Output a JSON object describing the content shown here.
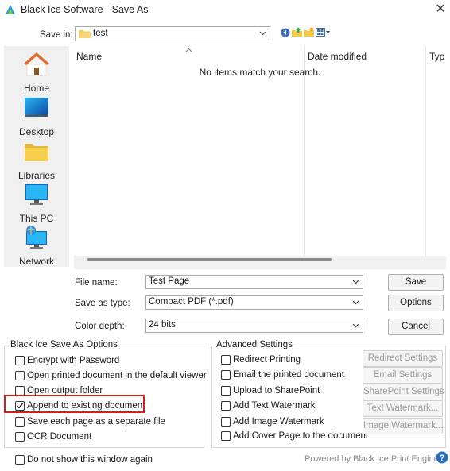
{
  "window": {
    "title": "Black Ice Software - Save As",
    "close_label": "✕"
  },
  "save_in": {
    "label": "Save in:",
    "value": "test"
  },
  "places": [
    {
      "label": "Home"
    },
    {
      "label": "Desktop"
    },
    {
      "label": "Libraries"
    },
    {
      "label": "This PC"
    },
    {
      "label": "Network"
    }
  ],
  "file_list": {
    "columns": [
      "Name",
      "Date modified",
      "Typ"
    ],
    "empty_message": "No items match your search."
  },
  "fields": {
    "file_name_label": "File name:",
    "file_name_value": "Test Page",
    "save_as_type_label": "Save as type:",
    "save_as_type_value": "Compact PDF (*.pdf)",
    "color_depth_label": "Color depth:",
    "color_depth_value": "24 bits"
  },
  "buttons": {
    "save": "Save",
    "options": "Options",
    "cancel": "Cancel"
  },
  "ice_options": {
    "title": "Black Ice Save As Options",
    "items": [
      {
        "label": "Encrypt with Password",
        "checked": false
      },
      {
        "label": "Open printed document in the default viewer",
        "checked": false
      },
      {
        "label": "Open output folder",
        "checked": false
      },
      {
        "label": "Append to existing document",
        "checked": true
      },
      {
        "label": "Save each page as a separate file",
        "checked": false
      },
      {
        "label": "OCR Document",
        "checked": false
      }
    ]
  },
  "advanced": {
    "title": "Advanced Settings",
    "items": [
      {
        "label": "Redirect Printing",
        "checked": false
      },
      {
        "label": "Email the printed document",
        "checked": false
      },
      {
        "label": "Upload to SharePoint",
        "checked": false
      },
      {
        "label": "Add Text Watermark",
        "checked": false
      },
      {
        "label": "Add Image Watermark",
        "checked": false
      },
      {
        "label": "Add Cover Page to the document",
        "checked": false
      }
    ],
    "buttons": [
      "Redirect Settings",
      "Email Settings",
      "SharePoint Settings",
      "Text Watermark...",
      "Image Watermark..."
    ]
  },
  "footer": {
    "dont_show": "Do not show this window again",
    "powered_by": "Powered by Black Ice Print Engine"
  },
  "colors": {
    "highlight_box": "#d21f1f",
    "folder_yellow": "#f2c94c",
    "monitor_blue": "#1e88e5"
  }
}
